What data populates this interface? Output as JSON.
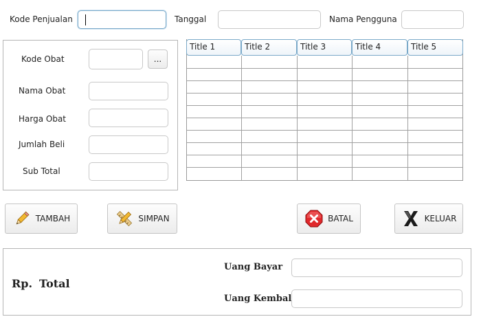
{
  "top": {
    "kode_penjualan_label": "Kode Penjualan",
    "kode_penjualan_value": "",
    "tanggal_label": "Tanggal",
    "tanggal_value": "",
    "nama_pengguna_label": "Nama Pengguna",
    "nama_pengguna_value": ""
  },
  "form": {
    "kode_obat_label": "Kode Obat",
    "browse_label": "...",
    "nama_obat_label": "Nama Obat",
    "harga_obat_label": "Harga Obat",
    "jumlah_beli_label": "Jumlah Beli",
    "sub_total_label": "Sub Total"
  },
  "table": {
    "columns": [
      "Title 1",
      "Title 2",
      "Title 3",
      "Title 4",
      "Title 5"
    ]
  },
  "buttons": {
    "tambah": "TAMBAH",
    "simpan": "SIMPAN",
    "batal": "BATAL",
    "keluar": "KELUAR"
  },
  "icons": {
    "tambah": "pencil-icon",
    "simpan": "pencil-ruler-icon",
    "batal": "red-x-octagon-icon",
    "keluar": "black-x-icon"
  },
  "footer": {
    "rp_label": "Rp.",
    "total_label": "Total",
    "uang_bayar_label": "Uang Bayar",
    "uang_kembali_label": "Uang Kembali"
  }
}
